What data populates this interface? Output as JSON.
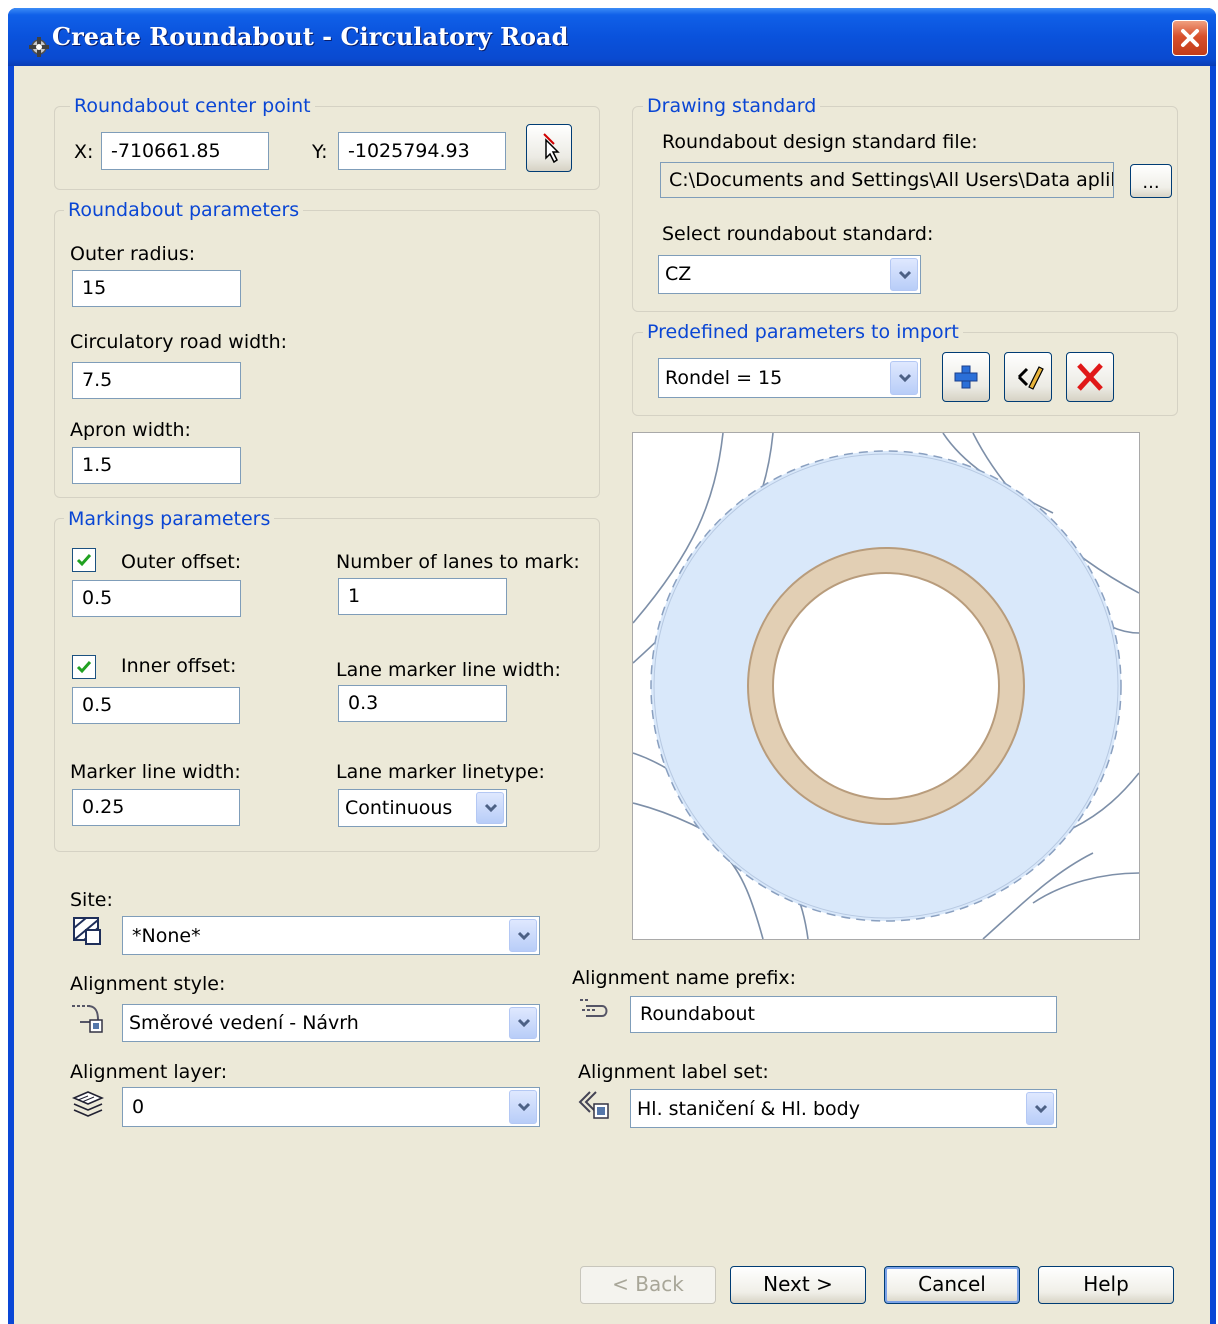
{
  "window": {
    "title": "Create Roundabout - Circulatory Road"
  },
  "center_point": {
    "group_label": "Roundabout center point",
    "x_label": "X:",
    "x_value": "-710661.85",
    "y_label": "Y:",
    "y_value": "-1025794.93"
  },
  "parameters": {
    "group_label": "Roundabout parameters",
    "outer_radius_label": "Outer radius:",
    "outer_radius_value": "15",
    "road_width_label": "Circulatory road width:",
    "road_width_value": "7.5",
    "apron_width_label": "Apron width:",
    "apron_width_value": "1.5"
  },
  "markings": {
    "group_label": "Markings parameters",
    "outer_offset_label": "Outer offset:",
    "outer_offset_checked": true,
    "outer_offset_value": "0.5",
    "lanes_label": "Number of lanes to mark:",
    "lanes_value": "1",
    "inner_offset_label": "Inner offset:",
    "inner_offset_checked": true,
    "inner_offset_value": "0.5",
    "lane_line_width_label": "Lane marker line width:",
    "lane_line_width_value": "0.3",
    "marker_width_label": "Marker line width:",
    "marker_width_value": "0.25",
    "linetype_label": "Lane marker linetype:",
    "linetype_value": "Continuous"
  },
  "drawing_standard": {
    "group_label": "Drawing standard",
    "file_label": "Roundabout design standard file:",
    "file_value": "C:\\Documents and Settings\\All Users\\Data aplika",
    "browse_label": "...",
    "standard_label": "Select roundabout standard:",
    "standard_value": "CZ"
  },
  "predefined": {
    "group_label": "Predefined parameters to import",
    "value": "Rondel = 15"
  },
  "site": {
    "label": "Site:",
    "value": "*None*"
  },
  "alignment_style": {
    "label": "Alignment style:",
    "value": "Směrové vedení - Návrh"
  },
  "alignment_layer": {
    "label": "Alignment layer:",
    "value": "0"
  },
  "alignment_prefix": {
    "label": "Alignment name prefix:",
    "value": "Roundabout"
  },
  "alignment_labels": {
    "label": "Alignment label set:",
    "value": "Hl. staničení & Hl. body"
  },
  "buttons": {
    "back": "< Back",
    "next": "Next >",
    "cancel": "Cancel",
    "help": "Help"
  },
  "colors": {
    "title_bar": "#0a52dc",
    "dialog_bg": "#ece9d8",
    "group_label": "#0a46d4",
    "road_fill": "#d9e8fa",
    "island_ring": "#e2cfb4",
    "island_border": "#b89c7c"
  }
}
